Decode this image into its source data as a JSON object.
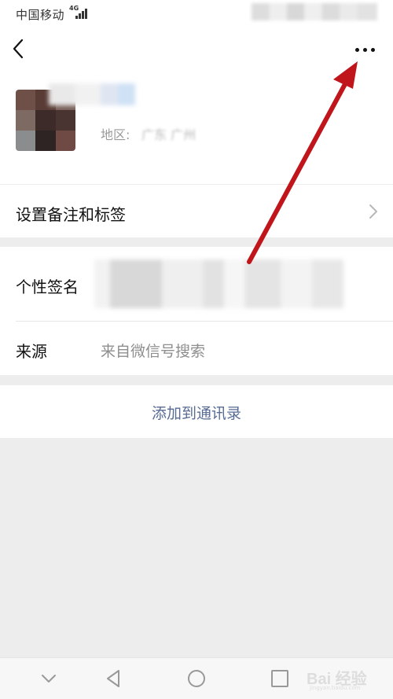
{
  "status_bar": {
    "carrier": "中国移动",
    "network": "4G"
  },
  "nav": {
    "back_icon": "chevron-left-icon",
    "more_icon": "ellipsis-icon"
  },
  "profile": {
    "region_label": "地区:",
    "region_value": "广东 广州"
  },
  "rows": {
    "remark_label": "设置备注和标签",
    "signature_label": "个性签名",
    "source_label": "来源",
    "source_value": "来自微信号搜索"
  },
  "actions": {
    "add_contact_label": "添加到通讯录"
  },
  "system_nav": {
    "icons": [
      "chevron-down-icon",
      "back-triangle-icon",
      "home-circle-icon",
      "recents-square-icon"
    ]
  },
  "watermark": {
    "text": "Bai 经验",
    "url": "jingyan.baidu.com"
  },
  "colors": {
    "link": "#576b95",
    "arrow": "#c0151b",
    "background": "#ededed"
  }
}
